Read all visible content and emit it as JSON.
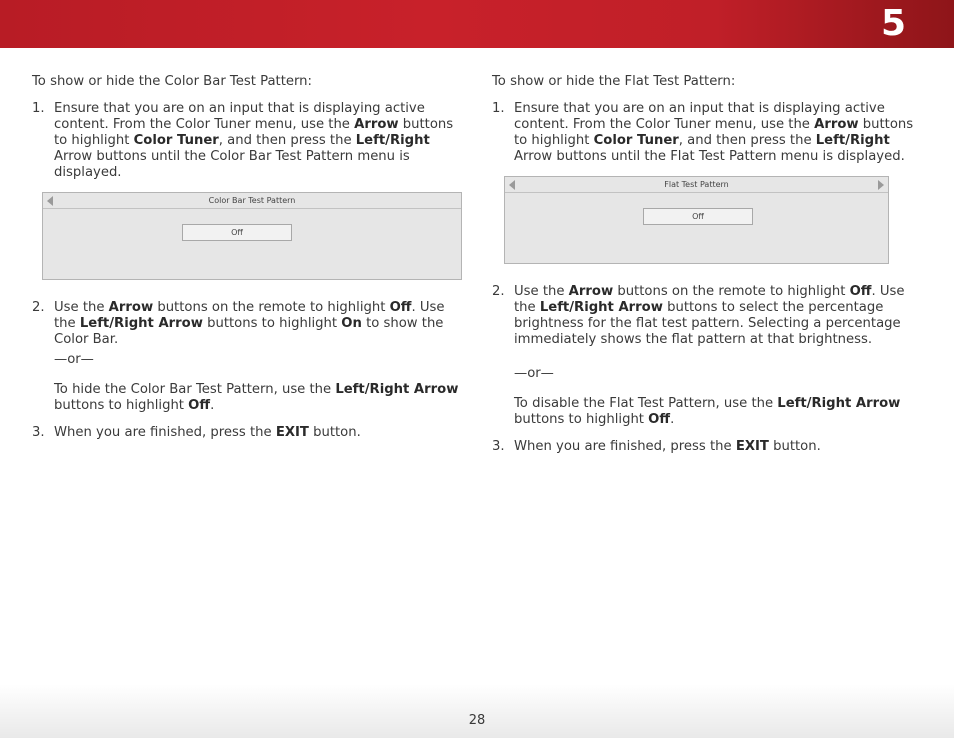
{
  "header": {
    "chapter_number": "5"
  },
  "left": {
    "intro": "To show or hide the Color Bar Test Pattern:",
    "step1": {
      "num": "1.",
      "t1": "Ensure that you are on an input that is displaying active content. From the Color Tuner menu, use the ",
      "b1": "Arrow",
      "t2": " buttons to highlight ",
      "b2": "Color Tuner",
      "t3": ", and then press the ",
      "b3": "Left/Right",
      "t4": " Arrow buttons until the Color Bar Test Pattern menu is displayed."
    },
    "menu": {
      "title": "Color Bar Test Pattern",
      "value": "Off"
    },
    "step2": {
      "num": "2.",
      "t1": "Use the ",
      "b1": "Arrow",
      "t2": " buttons on the remote to highlight ",
      "b2": "Off",
      "t3": ". Use the ",
      "b3": "Left/Right Arrow",
      "t4": " buttons to highlight ",
      "b4": "On",
      "t5": " to show the Color Bar.",
      "or": "—or—",
      "t6": "To hide the Color Bar Test Pattern, use the ",
      "b5": "Left/Right Arrow",
      "t7": " buttons to highlight ",
      "b6": "Off",
      "t8": "."
    },
    "step3": {
      "num": "3.",
      "t1": "When you are finished, press the ",
      "b1": "EXIT",
      "t2": " button."
    }
  },
  "right": {
    "intro": "To show or hide the Flat Test Pattern:",
    "step1": {
      "num": "1.",
      "t1": "Ensure that you are on an input that is displaying active content. From the Color Tuner menu, use the ",
      "b1": "Arrow",
      "t2": " buttons to highlight ",
      "b2": "Color Tuner",
      "t3": ", and then press the ",
      "b3": "Left/Right",
      "t4": " Arrow buttons until the Flat Test Pattern menu is displayed."
    },
    "menu": {
      "title": "Flat Test Pattern",
      "value": "Off"
    },
    "step2": {
      "num": "2.",
      "t1": "Use the ",
      "b1": "Arrow",
      "t2": " buttons on the remote to highlight ",
      "b2": "Off",
      "t3": ". Use the ",
      "b3": "Left/Right Arrow",
      "t4": " buttons to select the percentage brightness for the flat test pattern. Selecting a percentage immediately shows the flat pattern at that brightness.",
      "or": "—or—",
      "t5": "To disable the Flat Test Pattern, use the ",
      "b4": "Left/Right Arrow",
      "t6": " buttons to highlight ",
      "b5": "Off",
      "t7": "."
    },
    "step3": {
      "num": "3.",
      "t1": "When you are finished, press the ",
      "b1": "EXIT",
      "t2": " button."
    }
  },
  "footer": {
    "page_number": "28"
  },
  "colors": {
    "banner_red": "#c8212a",
    "banner_dark": "#8e1519"
  }
}
